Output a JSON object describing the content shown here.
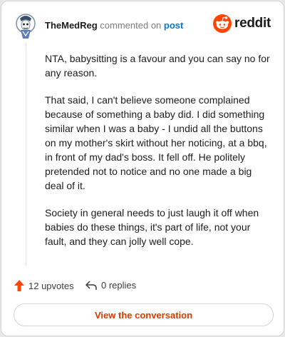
{
  "header": {
    "author": "TheMedReg",
    "action": "commented on",
    "post_link": "post",
    "brand": "reddit"
  },
  "comment": {
    "paragraphs": [
      "NTA, babysitting is a favour and you can say no for any reason.",
      "That said, I can't believe someone complained because of something a baby did. I did something similar when I was a baby - I undid all the buttons on my mother's skirt without her noticing, at a bbq, in front of my dad's boss. It fell off. He politely pretended not to notice and no one made a big deal of it.",
      "Society in general needs to just laugh it off when babies do these things, it's part of life, not your fault, and they can jolly well cope."
    ]
  },
  "footer": {
    "upvotes": "12 upvotes",
    "replies": "0 replies"
  },
  "cta": {
    "label": "View the conversation"
  },
  "colors": {
    "brand_orange": "#ff4500",
    "link_blue": "#0079d3",
    "cta_text": "#d93a00"
  }
}
